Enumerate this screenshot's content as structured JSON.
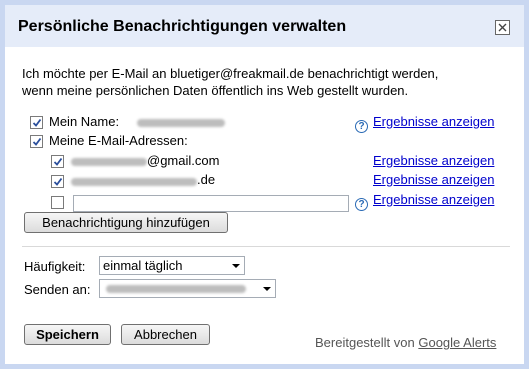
{
  "dialog": {
    "title": "Persönliche Benachrichtigungen verwalten",
    "close_icon": "close-icon"
  },
  "intro": {
    "line1": "Ich möchte per E-Mail an bluetiger@freakmail.de benachrichtigt werden,",
    "line2": "wenn meine persönlichen Daten öffentlich ins Web gestellt wurden."
  },
  "options": {
    "name_label": "Mein Name:",
    "name_checked": true,
    "emails_label": "Meine E-Mail-Adressen:",
    "emails_checked": true,
    "email1_suffix": "@gmail.com",
    "email1_checked": true,
    "email2_suffix": ".de",
    "email2_checked": true,
    "email3_value": "",
    "email3_checked": false,
    "results_link": "Ergebnisse anzeigen",
    "help_icon": "help-icon"
  },
  "buttons": {
    "add_notification": "Benachrichtigung hinzufügen",
    "save": "Speichern",
    "cancel": "Abbrechen"
  },
  "settings": {
    "frequency_label": "Häufigkeit:",
    "frequency_value": "einmal täglich",
    "send_to_label": "Senden an:"
  },
  "footer": {
    "provided_by": "Bereitgestellt von",
    "provider_link": "Google Alerts"
  },
  "colors": {
    "page_background": "#c9d7f1",
    "titlebar_background": "#e5ecf9",
    "link": "#0000cc"
  }
}
